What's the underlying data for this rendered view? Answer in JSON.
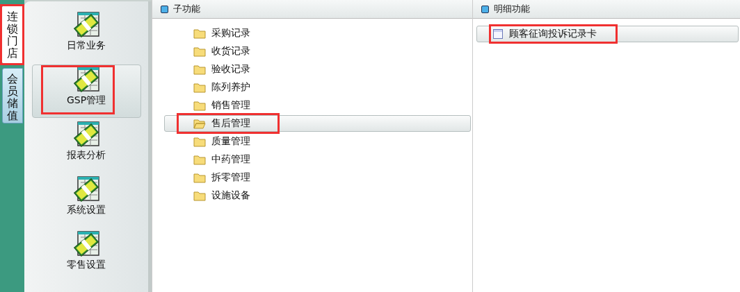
{
  "side_tabs": [
    {
      "label": "连锁门店",
      "selected": true,
      "highlighted": true
    },
    {
      "label": "会员储值",
      "selected": false,
      "highlighted": false
    }
  ],
  "modules": [
    {
      "label": "日常业务",
      "selected": false,
      "highlighted": false
    },
    {
      "label": "GSP管理",
      "selected": true,
      "highlighted": true
    },
    {
      "label": "报表分析",
      "selected": false,
      "highlighted": false
    },
    {
      "label": "系统设置",
      "selected": false,
      "highlighted": false
    },
    {
      "label": "零售设置",
      "selected": false,
      "highlighted": false
    }
  ],
  "sub_panel": {
    "title": "子功能",
    "items": [
      {
        "label": "采购记录",
        "selected": false,
        "highlighted": false
      },
      {
        "label": "收货记录",
        "selected": false,
        "highlighted": false
      },
      {
        "label": "验收记录",
        "selected": false,
        "highlighted": false
      },
      {
        "label": "陈列养护",
        "selected": false,
        "highlighted": false
      },
      {
        "label": "销售管理",
        "selected": false,
        "highlighted": false
      },
      {
        "label": "售后管理",
        "selected": true,
        "highlighted": true
      },
      {
        "label": "质量管理",
        "selected": false,
        "highlighted": false
      },
      {
        "label": "中药管理",
        "selected": false,
        "highlighted": false
      },
      {
        "label": "拆零管理",
        "selected": false,
        "highlighted": false
      },
      {
        "label": "设施设备",
        "selected": false,
        "highlighted": false
      }
    ]
  },
  "detail_panel": {
    "title": "明细功能",
    "items": [
      {
        "label": "顾客征询投诉记录卡",
        "selected": true,
        "highlighted": true
      }
    ]
  }
}
